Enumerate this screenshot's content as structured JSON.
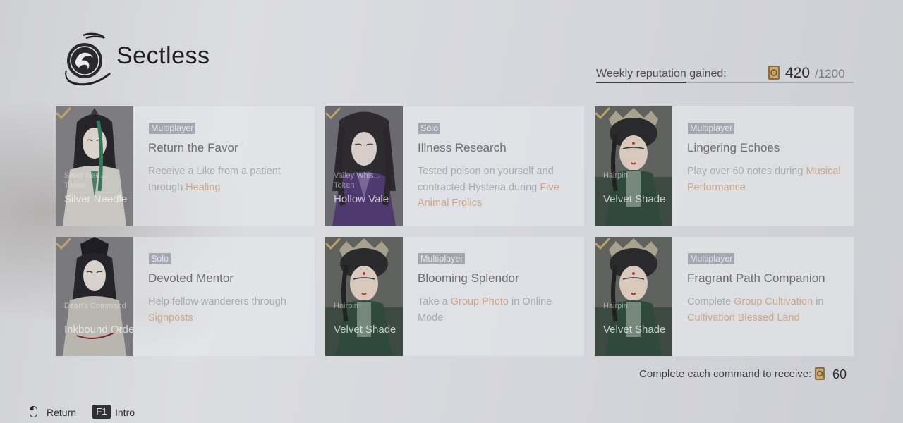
{
  "header": {
    "title": "Sectless",
    "emblem_icon": "sect-emblem-icon"
  },
  "reputation": {
    "label": "Weekly reputation gained:",
    "current": "420",
    "max": "/1200",
    "progress_fraction": 0.35,
    "icon": "reputation-token-icon"
  },
  "commands": [
    {
      "type": "Multiplayer",
      "title": "Return the Favor",
      "desc": [
        {
          "t": "Receive a Like from a patient through "
        },
        {
          "t": "Healing",
          "hl": true
        }
      ],
      "reward_sub1": "Silver Nee...",
      "reward_sub2": "Token",
      "reward_name": "Silver Needle",
      "completed": true,
      "portrait": "scholar-green"
    },
    {
      "type": "Solo",
      "title": "Illness Research",
      "desc": [
        {
          "t": "Tested poison on yourself and contracted Hysteria during "
        },
        {
          "t": "Five Animal Frolics",
          "hl": true
        }
      ],
      "reward_sub1": "Valley Whis...",
      "reward_sub2": "Token",
      "reward_name": "Hollow Vale",
      "completed": true,
      "portrait": "man-purple"
    },
    {
      "type": "Multiplayer",
      "title": "Lingering Echoes",
      "desc": [
        {
          "t": "Play over 60 notes during "
        },
        {
          "t": "Musical Performance",
          "hl": true
        }
      ],
      "reward_sub1": "Hairpin",
      "reward_sub2": "",
      "reward_name": "Velvet Shade",
      "completed": true,
      "portrait": "lady-crown"
    },
    {
      "type": "Solo",
      "title": "Devoted Mentor",
      "desc": [
        {
          "t": "Help fellow wanderers through "
        },
        {
          "t": "Signposts",
          "hl": true
        }
      ],
      "reward_sub1": "Dean's Command",
      "reward_sub2": "",
      "reward_name": "Inkbound Order",
      "completed": true,
      "portrait": "scholar-black"
    },
    {
      "type": "Multiplayer",
      "title": "Blooming Splendor",
      "desc": [
        {
          "t": "Take a "
        },
        {
          "t": "Group Photo",
          "hl": true
        },
        {
          "t": " in Online Mode"
        }
      ],
      "reward_sub1": "Hairpin",
      "reward_sub2": "",
      "reward_name": "Velvet Shade",
      "completed": true,
      "portrait": "lady-crown"
    },
    {
      "type": "Multiplayer",
      "title": "Fragrant Path Companion",
      "desc": [
        {
          "t": "Complete "
        },
        {
          "t": "Group Cultivation",
          "hl": true
        },
        {
          "t": " in "
        },
        {
          "t": "Cultivation Blessed Land",
          "hl": true
        }
      ],
      "reward_sub1": "Hairpin",
      "reward_sub2": "",
      "reward_name": "Velvet Shade",
      "completed": true,
      "portrait": "lady-crown"
    }
  ],
  "completion_reward": {
    "label": "Complete each command to receive:",
    "value": "60",
    "icon": "reputation-token-icon"
  },
  "footer": {
    "return_label": "Return",
    "return_icon": "mouse-icon",
    "intro_key": "F1",
    "intro_label": "Intro"
  },
  "colors": {
    "highlight": "#cba88a",
    "tag_bg": "#a5a6b0",
    "check": "#c9a96a"
  }
}
